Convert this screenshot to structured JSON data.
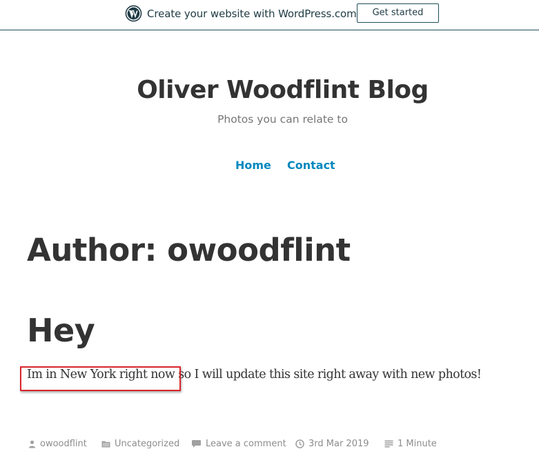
{
  "banner": {
    "text": "Create your website with WordPress.com",
    "button_label": "Get started",
    "icon": "wordpress-logo-icon"
  },
  "site": {
    "title": "Oliver Woodflint Blog",
    "description": "Photos you can relate to"
  },
  "nav": {
    "items": [
      {
        "label": "Home"
      },
      {
        "label": "Contact"
      }
    ]
  },
  "archive": {
    "title": "Author: owoodflint"
  },
  "post": {
    "title": "Hey",
    "body_highlighted": "Im in New York right now",
    "body_rest": " so I will update this site right away with new photos!",
    "meta": {
      "author": "owoodflint",
      "category": "Uncategorized",
      "comment": "Leave a comment",
      "date": "3rd Mar 2019",
      "read_time": "1 Minute"
    }
  },
  "colors": {
    "link": "#0087be",
    "highlight_border": "#d9262b",
    "meta_text": "#8d8d8d",
    "banner_border": "#1d4e59"
  }
}
